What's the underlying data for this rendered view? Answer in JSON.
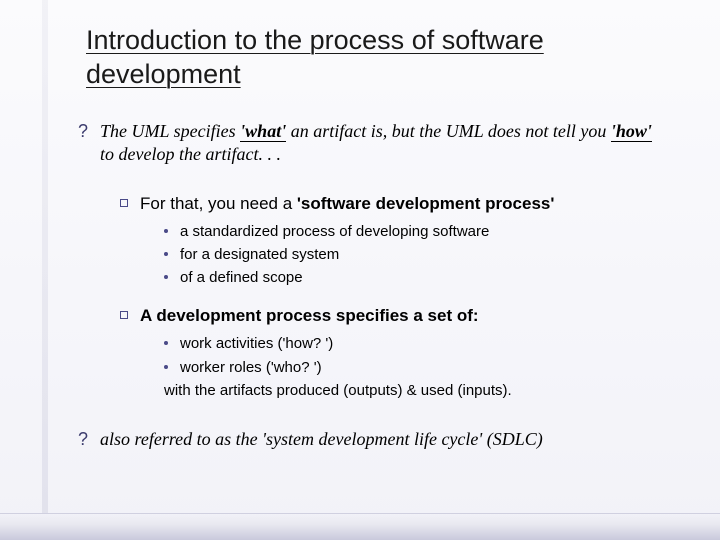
{
  "title": "Introduction to the process of software development",
  "p1_pre": "The UML specifies ",
  "p1_w1": "'what'",
  "p1_mid": " an artifact is, but the UML does not tell you ",
  "p1_w2": "'how'",
  "p1_post": " to develop the artifact. . .",
  "q1_pre": "For that, you need a ",
  "q1_bold": "'software development process'",
  "q1_b1": "a standardized process of developing software",
  "q1_b2": "for a designated system",
  "q1_b3": "of a defined scope",
  "q2": "A development process specifies a set of:",
  "q2_b1": "work activities ('how? ')",
  "q2_b2": "worker roles ('who? ')",
  "q2_tail": "with the artifacts produced (outputs) & used (inputs).",
  "p2": "also referred to as the 'system development life cycle' (SDLC)",
  "bullet_glyph": "?"
}
